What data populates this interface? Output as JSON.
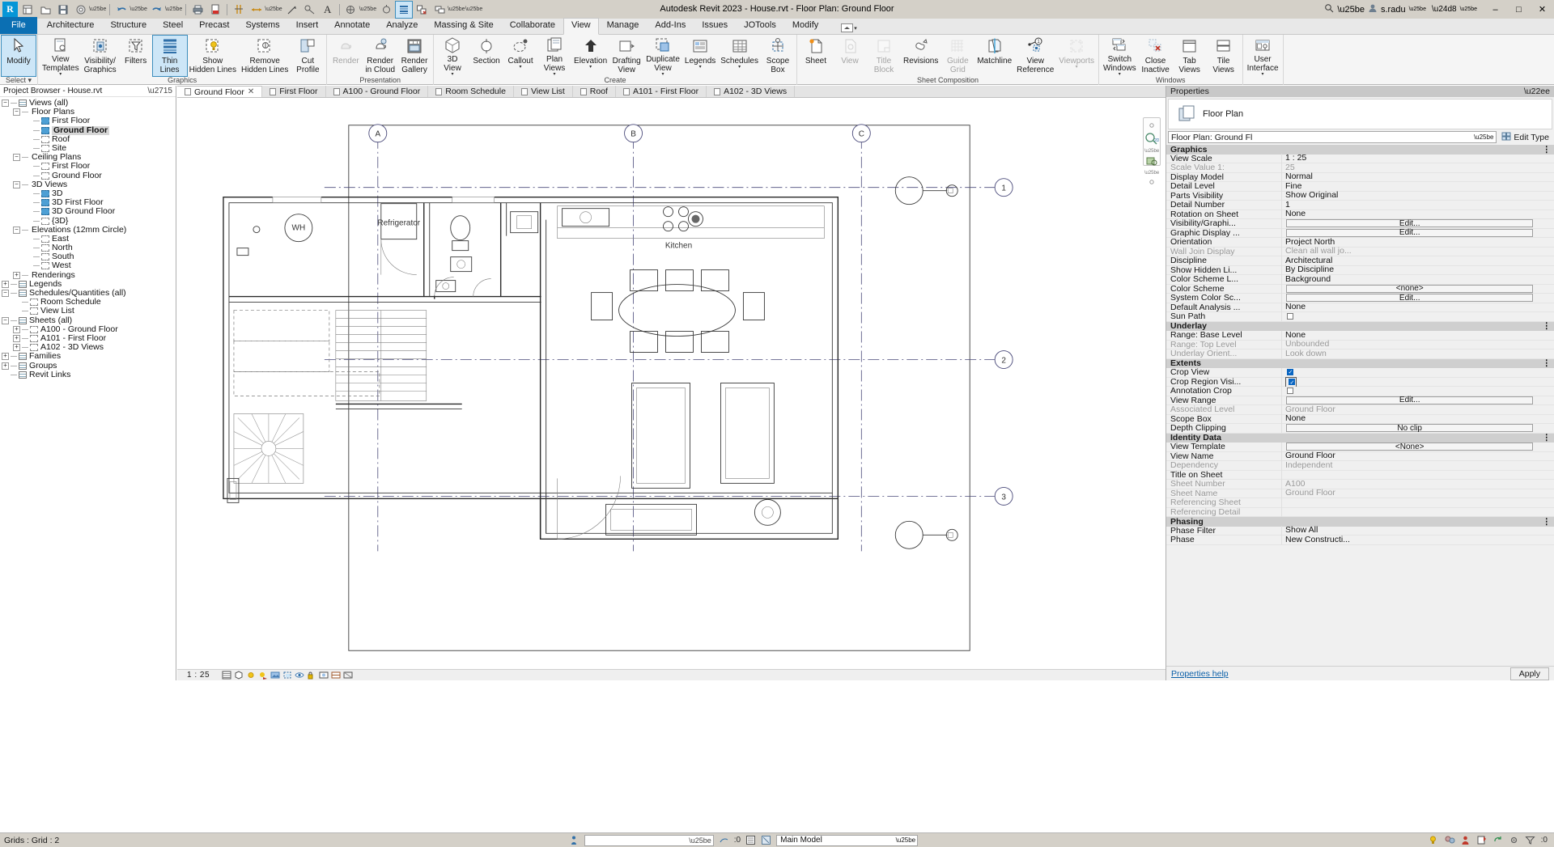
{
  "app": {
    "title": "Autodesk Revit 2023 - House.rvt - Floor Plan: Ground Floor",
    "account": "s.radu",
    "logo": "R"
  },
  "window_controls": {
    "minimize": "–",
    "maximize": "□",
    "close": "✕"
  },
  "quick_access": [
    {
      "name": "new-project-icon",
      "glyph": "▤"
    },
    {
      "name": "open-icon",
      "glyph": "▷"
    },
    {
      "name": "save-icon",
      "glyph": "Ὃe"
    },
    {
      "name": "save-as-icon",
      "glyph": "◎"
    },
    {
      "name": "undo-icon",
      "glyph": "↶"
    },
    {
      "name": "redo-icon",
      "glyph": "↷"
    },
    {
      "name": "print-icon",
      "glyph": "⎙"
    },
    {
      "name": "export-pdf-icon",
      "glyph": "⤓"
    },
    {
      "name": "measure-icon",
      "glyph": "⇔"
    },
    {
      "name": "aligned-dimension-icon",
      "glyph": "↔"
    },
    {
      "name": "tag-icon",
      "glyph": "↗"
    },
    {
      "name": "text-icon",
      "glyph": "A"
    },
    {
      "name": "default-3d-view-icon",
      "glyph": "◔"
    },
    {
      "name": "section-icon",
      "glyph": "◇"
    },
    {
      "name": "thin-lines-icon",
      "glyph": "≡"
    },
    {
      "name": "close-hidden-windows-icon",
      "glyph": "⌧"
    },
    {
      "name": "switch-windows-icon",
      "glyph": "⧉"
    },
    {
      "name": "customize-qat-icon",
      "glyph": "▾"
    }
  ],
  "ribbon": {
    "tabs": [
      {
        "label": "File",
        "kind": "file"
      },
      {
        "label": "Architecture"
      },
      {
        "label": "Structure"
      },
      {
        "label": "Steel"
      },
      {
        "label": "Precast"
      },
      {
        "label": "Systems"
      },
      {
        "label": "Insert"
      },
      {
        "label": "Annotate"
      },
      {
        "label": "Analyze"
      },
      {
        "label": "Massing & Site"
      },
      {
        "label": "Collaborate"
      },
      {
        "label": "View",
        "active": true
      },
      {
        "label": "Manage"
      },
      {
        "label": "Add-Ins"
      },
      {
        "label": "Issues"
      },
      {
        "label": "JOTools"
      },
      {
        "label": "Modify"
      }
    ],
    "panels": [
      {
        "name": "select",
        "label": "Select ▾",
        "buttons": [
          {
            "label": "Modify",
            "icon": "cursor-arrow-icon",
            "state": "selected",
            "split": false
          }
        ]
      },
      {
        "name": "graphics",
        "label": "Graphics",
        "buttons": [
          {
            "label": "View\nTemplates",
            "icon": "view-templates-icon",
            "split": true
          },
          {
            "label": "Visibility/\nGraphics",
            "icon": "visibility-graphics-icon"
          },
          {
            "label": "Filters",
            "icon": "filters-icon"
          },
          {
            "label": "Thin\nLines",
            "icon": "thin-lines-icon",
            "state": "active"
          },
          {
            "label": "Show\nHidden Lines",
            "icon": "show-hidden-lines-icon"
          },
          {
            "label": "Remove\nHidden Lines",
            "icon": "remove-hidden-lines-icon"
          },
          {
            "label": "Cut\nProfile",
            "icon": "cut-profile-icon"
          }
        ]
      },
      {
        "name": "presentation",
        "label": "Presentation",
        "buttons": [
          {
            "label": "Render",
            "icon": "render-icon",
            "state": "disabled"
          },
          {
            "label": "Render\nin Cloud",
            "icon": "render-cloud-icon"
          },
          {
            "label": "Render\nGallery",
            "icon": "render-gallery-icon"
          }
        ]
      },
      {
        "name": "create",
        "label": "Create",
        "buttons": [
          {
            "label": "3D\nView",
            "icon": "3d-view-icon",
            "split": true
          },
          {
            "label": "Section",
            "icon": "section-icon"
          },
          {
            "label": "Callout",
            "icon": "callout-icon",
            "split": true
          },
          {
            "label": "Plan\nViews",
            "icon": "plan-views-icon",
            "split": true
          },
          {
            "label": "Elevation",
            "icon": "elevation-icon",
            "split": true
          },
          {
            "label": "Drafting\nView",
            "icon": "drafting-view-icon"
          },
          {
            "label": "Duplicate\nView",
            "icon": "duplicate-view-icon",
            "split": true
          },
          {
            "label": "Legends",
            "icon": "legends-icon",
            "split": true
          },
          {
            "label": "Schedules",
            "icon": "schedules-icon",
            "split": true
          },
          {
            "label": "Scope\nBox",
            "icon": "scope-box-icon"
          }
        ]
      },
      {
        "name": "sheet-composition",
        "label": "Sheet Composition",
        "buttons": [
          {
            "label": "Sheet",
            "icon": "sheet-icon"
          },
          {
            "label": "View",
            "icon": "view-icon",
            "state": "disabled"
          },
          {
            "label": "Title\nBlock",
            "icon": "title-block-icon",
            "state": "disabled"
          },
          {
            "label": "Revisions",
            "icon": "revisions-icon"
          },
          {
            "label": "Guide\nGrid",
            "icon": "guide-grid-icon",
            "state": "disabled"
          },
          {
            "label": "Matchline",
            "icon": "matchline-icon"
          },
          {
            "label": "View\nReference",
            "icon": "view-reference-icon"
          },
          {
            "label": "Viewports",
            "icon": "viewports-icon",
            "state": "disabled",
            "split": true
          }
        ]
      },
      {
        "name": "windows",
        "label": "Windows",
        "buttons": [
          {
            "label": "Switch\nWindows",
            "icon": "switch-windows-icon",
            "split": true
          },
          {
            "label": "Close\nInactive",
            "icon": "close-inactive-icon"
          },
          {
            "label": "Tab\nViews",
            "icon": "tab-views-icon"
          },
          {
            "label": "Tile\nViews",
            "icon": "tile-views-icon"
          }
        ]
      },
      {
        "name": "user-interface",
        "label": "",
        "buttons": [
          {
            "label": "User\nInterface",
            "icon": "user-interface-icon",
            "split": true
          }
        ]
      }
    ]
  },
  "browser": {
    "title": "Project Browser - House.rvt",
    "items": [
      {
        "label": "Views (all)",
        "indent": 0,
        "toggle": "minus",
        "icon": "views-all-icon"
      },
      {
        "label": "Floor Plans",
        "indent": 1,
        "toggle": "minus",
        "icon": "folder-icon"
      },
      {
        "label": "First Floor",
        "indent": 2,
        "toggle": "none",
        "icon": "view-icon-blue"
      },
      {
        "label": "Ground Floor",
        "indent": 2,
        "toggle": "none",
        "icon": "view-icon-blue",
        "selected": true
      },
      {
        "label": "Roof",
        "indent": 2,
        "toggle": "none",
        "icon": "view-icon"
      },
      {
        "label": "Site",
        "indent": 2,
        "toggle": "none",
        "icon": "view-icon"
      },
      {
        "label": "Ceiling Plans",
        "indent": 1,
        "toggle": "minus",
        "icon": "folder-icon"
      },
      {
        "label": "First Floor",
        "indent": 2,
        "toggle": "none",
        "icon": "view-icon"
      },
      {
        "label": "Ground Floor",
        "indent": 2,
        "toggle": "none",
        "icon": "view-icon"
      },
      {
        "label": "3D Views",
        "indent": 1,
        "toggle": "minus",
        "icon": "folder-icon"
      },
      {
        "label": "3D",
        "indent": 2,
        "toggle": "none",
        "icon": "view-icon-blue"
      },
      {
        "label": "3D First Floor",
        "indent": 2,
        "toggle": "none",
        "icon": "view-icon-blue"
      },
      {
        "label": "3D Ground Floor",
        "indent": 2,
        "toggle": "none",
        "icon": "view-icon-blue"
      },
      {
        "label": "{3D}",
        "indent": 2,
        "toggle": "none",
        "icon": "view-icon"
      },
      {
        "label": "Elevations (12mm Circle)",
        "indent": 1,
        "toggle": "minus",
        "icon": "folder-icon"
      },
      {
        "label": "East",
        "indent": 2,
        "toggle": "none",
        "icon": "view-icon"
      },
      {
        "label": "North",
        "indent": 2,
        "toggle": "none",
        "icon": "view-icon"
      },
      {
        "label": "South",
        "indent": 2,
        "toggle": "none",
        "icon": "view-icon"
      },
      {
        "label": "West",
        "indent": 2,
        "toggle": "none",
        "icon": "view-icon"
      },
      {
        "label": "Renderings",
        "indent": 1,
        "toggle": "plus",
        "icon": "folder-icon"
      },
      {
        "label": "Legends",
        "indent": 0,
        "toggle": "plus",
        "icon": "legends-icon"
      },
      {
        "label": "Schedules/Quantities (all)",
        "indent": 0,
        "toggle": "minus",
        "icon": "schedule-icon"
      },
      {
        "label": "Room Schedule",
        "indent": 1,
        "toggle": "none",
        "icon": "view-icon"
      },
      {
        "label": "View List",
        "indent": 1,
        "toggle": "none",
        "icon": "view-icon"
      },
      {
        "label": "Sheets (all)",
        "indent": 0,
        "toggle": "minus",
        "icon": "sheets-icon"
      },
      {
        "label": "A100 - Ground Floor",
        "indent": 1,
        "toggle": "plus",
        "icon": "sheet-icon"
      },
      {
        "label": "A101 - First Floor",
        "indent": 1,
        "toggle": "plus",
        "icon": "sheet-icon"
      },
      {
        "label": "A102 - 3D Views",
        "indent": 1,
        "toggle": "plus",
        "icon": "sheet-icon"
      },
      {
        "label": "Families",
        "indent": 0,
        "toggle": "plus",
        "icon": "families-icon"
      },
      {
        "label": "Groups",
        "indent": 0,
        "toggle": "plus",
        "icon": "groups-icon"
      },
      {
        "label": "Revit Links",
        "indent": 0,
        "toggle": "none",
        "icon": "revit-links-icon"
      }
    ]
  },
  "doc_tabs": [
    {
      "label": "Ground Floor",
      "active": true,
      "closable": true
    },
    {
      "label": "First Floor"
    },
    {
      "label": "A100 - Ground Floor"
    },
    {
      "label": "Room Schedule"
    },
    {
      "label": "View List"
    },
    {
      "label": "Roof"
    },
    {
      "label": "A101 - First Floor"
    },
    {
      "label": "A102 - 3D Views"
    }
  ],
  "view_control_bar": {
    "scale": "1 : 25",
    "icons": [
      "detail-level-icon",
      "visual-style-icon",
      "sun-path-icon",
      "shadows-icon",
      "render-dialog-icon",
      "crop-view-icon",
      "show-crop-region-icon",
      "lock-3d-view-icon",
      "temporary-hide-isolate-icon",
      "reveal-hidden-elements-icon",
      "analytical-model-icon"
    ]
  },
  "drawing": {
    "grid_labels_top": [
      "A",
      "B",
      "C"
    ],
    "grid_labels_right": [
      "1",
      "2",
      "3"
    ],
    "room_labels": [
      "WH",
      "Refrigerator",
      "Kitchen"
    ]
  },
  "properties": {
    "header": "Properties",
    "type_name": "Floor Plan",
    "selector_value": "Floor Plan: Ground Fl",
    "edit_type_label": "Edit Type",
    "footer_link": "Properties help",
    "apply_label": "Apply",
    "groups": [
      {
        "name": "Graphics",
        "rows": [
          {
            "name": "View Scale",
            "value": "1 : 25",
            "kind": "text"
          },
          {
            "name": "Scale Value    1:",
            "value": "25",
            "kind": "text",
            "dim": true
          },
          {
            "name": "Display Model",
            "value": "Normal",
            "kind": "text"
          },
          {
            "name": "Detail Level",
            "value": "Fine",
            "kind": "text"
          },
          {
            "name": "Parts Visibility",
            "value": "Show Original",
            "kind": "text"
          },
          {
            "name": "Detail Number",
            "value": "1",
            "kind": "text"
          },
          {
            "name": "Rotation on Sheet",
            "value": "None",
            "kind": "text"
          },
          {
            "name": "Visibility/Graphi...",
            "value": "Edit...",
            "kind": "button"
          },
          {
            "name": "Graphic Display ...",
            "value": "Edit...",
            "kind": "button"
          },
          {
            "name": "Orientation",
            "value": "Project North",
            "kind": "text"
          },
          {
            "name": "Wall Join Display",
            "value": "Clean all wall jo...",
            "kind": "text",
            "dim": true
          },
          {
            "name": "Discipline",
            "value": "Architectural",
            "kind": "text"
          },
          {
            "name": "Show Hidden Li...",
            "value": "By Discipline",
            "kind": "text"
          },
          {
            "name": "Color Scheme L...",
            "value": "Background",
            "kind": "text"
          },
          {
            "name": "Color Scheme",
            "value": "<none>",
            "kind": "button"
          },
          {
            "name": "System Color Sc...",
            "value": "Edit...",
            "kind": "button"
          },
          {
            "name": "Default Analysis ...",
            "value": "None",
            "kind": "text"
          },
          {
            "name": "Sun Path",
            "value": "",
            "kind": "checkbox",
            "checked": false
          }
        ]
      },
      {
        "name": "Underlay",
        "rows": [
          {
            "name": "Range: Base Level",
            "value": "None",
            "kind": "text"
          },
          {
            "name": "Range: Top Level",
            "value": "Unbounded",
            "kind": "text",
            "dim": true
          },
          {
            "name": "Underlay Orient...",
            "value": "Look down",
            "kind": "text",
            "dim": true
          }
        ]
      },
      {
        "name": "Extents",
        "rows": [
          {
            "name": "Crop View",
            "value": "",
            "kind": "checkbox",
            "checked": true
          },
          {
            "name": "Crop Region Visi...",
            "value": "",
            "kind": "checkbox",
            "checked": true,
            "focused": true
          },
          {
            "name": "Annotation Crop",
            "value": "",
            "kind": "checkbox",
            "checked": false
          },
          {
            "name": "View Range",
            "value": "Edit...",
            "kind": "button"
          },
          {
            "name": "Associated Level",
            "value": "Ground Floor",
            "kind": "text",
            "dim": true
          },
          {
            "name": "Scope Box",
            "value": "None",
            "kind": "text"
          },
          {
            "name": "Depth Clipping",
            "value": "No clip",
            "kind": "button"
          }
        ]
      },
      {
        "name": "Identity Data",
        "rows": [
          {
            "name": "View Template",
            "value": "<None>",
            "kind": "button"
          },
          {
            "name": "View Name",
            "value": "Ground Floor",
            "kind": "text"
          },
          {
            "name": "Dependency",
            "value": "Independent",
            "kind": "text",
            "dim": true
          },
          {
            "name": "Title on Sheet",
            "value": "",
            "kind": "text"
          },
          {
            "name": "Sheet Number",
            "value": "A100",
            "kind": "text",
            "dim": true
          },
          {
            "name": "Sheet Name",
            "value": "Ground Floor",
            "kind": "text",
            "dim": true
          },
          {
            "name": "Referencing Sheet",
            "value": "",
            "kind": "text",
            "dim": true
          },
          {
            "name": "Referencing Detail",
            "value": "",
            "kind": "text",
            "dim": true
          }
        ]
      },
      {
        "name": "Phasing",
        "rows": [
          {
            "name": "Phase Filter",
            "value": "Show All",
            "kind": "text"
          },
          {
            "name": "Phase",
            "value": "New Constructi...",
            "kind": "text"
          }
        ]
      }
    ]
  },
  "status_bar": {
    "message": "Grids : Grid : 2",
    "filter_placeholder": "",
    "workset_value": "",
    "model_value": "Main Model",
    "exclude_count": ":0",
    "filter_count": ":0",
    "right_icons": [
      "design-options-icon",
      "exclude-options-icon",
      "active-workset-icon",
      "editing-request-icon",
      "sync-icon",
      "worksharing-display-icon",
      "filter-icon"
    ]
  }
}
